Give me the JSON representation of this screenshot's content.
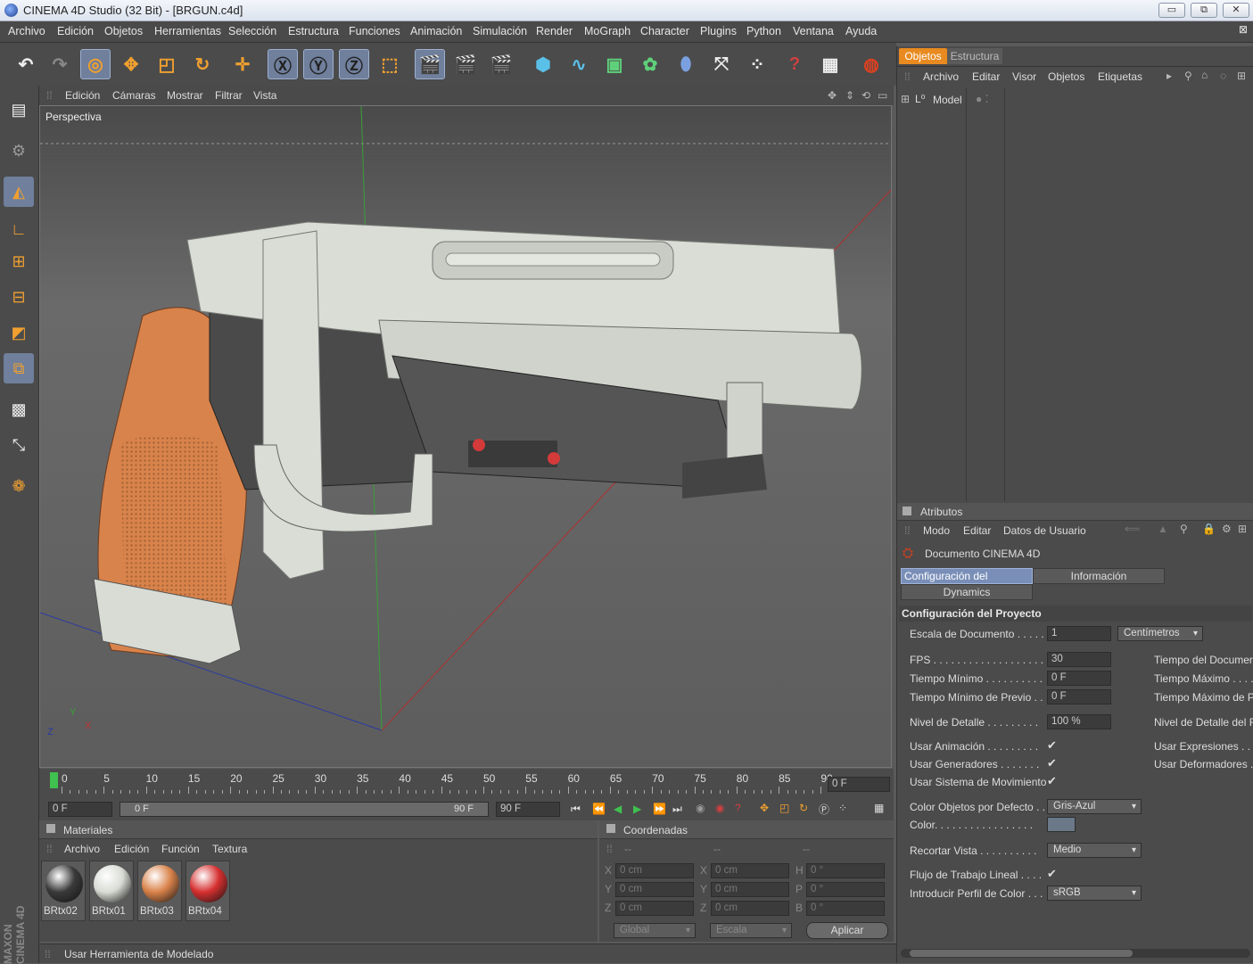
{
  "window": {
    "title": "CINEMA 4D Studio (32 Bit) - [BRGUN.c4d]",
    "min": "▭",
    "restore": "⧉",
    "close": "✕"
  },
  "menubar": [
    "Archivo",
    "Edición",
    "Objetos",
    "Herramientas",
    "Selección",
    "Estructura",
    "Funciones",
    "Animación",
    "Simulación",
    "Render",
    "MoGraph",
    "Character",
    "Plugins",
    "Python",
    "Ventana",
    "Ayuda"
  ],
  "viewport": {
    "menu": [
      "Edición",
      "Cámaras",
      "Mostrar",
      "Filtrar",
      "Vista"
    ],
    "label": "Perspectiva"
  },
  "timeline": {
    "ticks": [
      "0",
      "5",
      "10",
      "15",
      "20",
      "25",
      "30",
      "35",
      "40",
      "45",
      "50",
      "55",
      "60",
      "65",
      "70",
      "75",
      "80",
      "85",
      "90"
    ],
    "current": "0 F"
  },
  "playbar": {
    "start": "0 F",
    "slider_left": "0 F",
    "slider_right": "90 F",
    "end": "90 F"
  },
  "materials": {
    "title": "Materiales",
    "menu": [
      "Archivo",
      "Edición",
      "Función",
      "Textura"
    ],
    "items": [
      {
        "name": "BRtx02",
        "color": "#3a3a3a"
      },
      {
        "name": "BRtx01",
        "color": "#d8dcd4"
      },
      {
        "name": "BRtx03",
        "color": "#d9824a"
      },
      {
        "name": "BRtx04",
        "color": "#d63030"
      }
    ]
  },
  "coords": {
    "title": "Coordenadas",
    "headers": [
      "--",
      "--",
      "--"
    ],
    "rows": [
      [
        "X",
        "0 cm",
        "X",
        "0 cm",
        "H",
        "0 °"
      ],
      [
        "Y",
        "0 cm",
        "Y",
        "0 cm",
        "P",
        "0 °"
      ],
      [
        "Z",
        "0 cm",
        "Z",
        "0 cm",
        "B",
        "0 °"
      ]
    ],
    "mode1": "Global",
    "mode2": "Escala",
    "apply": "Aplicar"
  },
  "status": "Usar Herramienta de Modelado",
  "brand": "MAXON CINEMA 4D",
  "objects": {
    "tabs": [
      "Objetos",
      "Estructura"
    ],
    "menu": [
      "Archivo",
      "Editar",
      "Visor",
      "Objetos",
      "Etiquetas"
    ],
    "item": "Model"
  },
  "attributes": {
    "title": "Atributos",
    "menu": [
      "Modo",
      "Editar",
      "Datos de Usuario"
    ],
    "doc": "Documento CINEMA 4D",
    "tabs": [
      "Configuración del Proyecto",
      "Información",
      "Dynamics"
    ],
    "section": "Configuración del Proyecto",
    "scale_label": "Escala de Documento . . . . .",
    "scale_val": "1",
    "scale_unit": "Centímetros",
    "fps_label": "FPS . . . . . . . . . . . . . . . . . . . .",
    "fps_val": "30",
    "tmin_label": "Tiempo Mínimo . . . . . . . . . .",
    "tmin_val": "0 F",
    "tminp_label": "Tiempo Mínimo de Previo . .",
    "tminp_val": "0 F",
    "lod_label": "Nivel de Detalle . . . . . . . . .",
    "lod_val": "100 %",
    "anim_label": "Usar Animación . . . . . . . . .",
    "gen_label": "Usar Generadores . . . . . . .",
    "mov_label": "Usar Sistema de Movimiento",
    "r_tdoc": "Tiempo del Documer",
    "r_tmax": "Tiempo Máximo . . . .",
    "r_tmaxp": "Tiempo Máximo de P",
    "r_lod": "Nivel de Detalle del F",
    "r_expr": "Usar Expresiones . . .",
    "r_def": "Usar Deformadores . .",
    "col_label": "Color Objetos por Defecto . .",
    "col_val": "Gris-Azul",
    "color_label": "Color. . . . . . . . . . . . . . . . .",
    "crop_label": "Recortar Vista . . . . . . . . . .",
    "crop_val": "Medio",
    "flow_label": "Flujo de Trabajo Lineal . . . .",
    "profile_label": "Introducir Perfil de Color . . .",
    "profile_val": "sRGB",
    "check": "✔"
  }
}
